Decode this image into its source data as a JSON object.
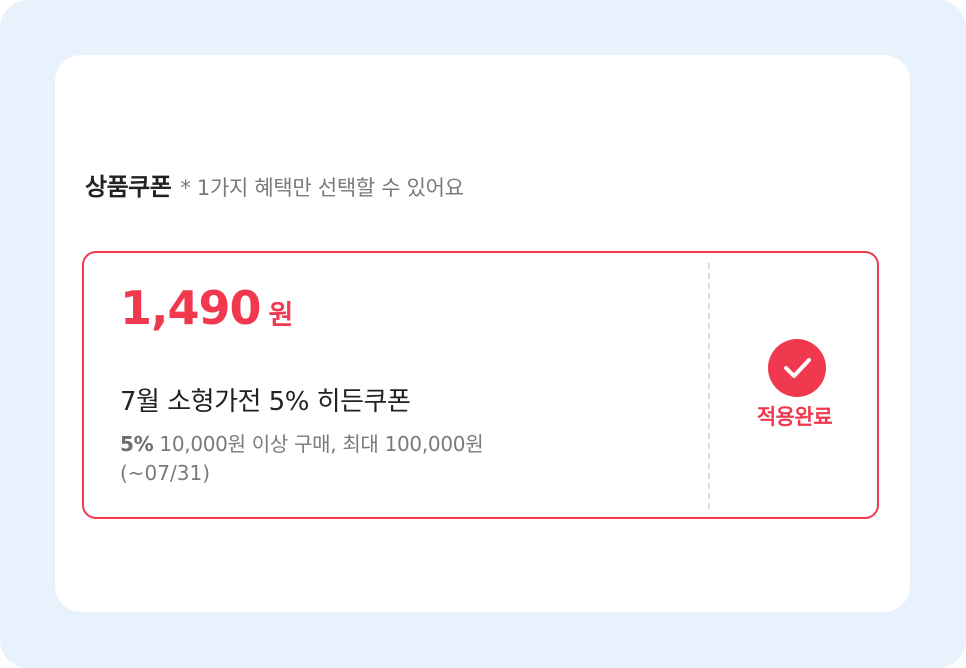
{
  "section": {
    "title": "상품쿠폰",
    "note": "* 1가지 혜택만 선택할 수 있어요"
  },
  "coupon": {
    "amount": "1,490",
    "amount_unit": "원",
    "name": "7월 소형가전 5% 히든쿠폰",
    "condition_rate": "5%",
    "condition_text": " 10,000원 이상 구매, 최대 100,000원",
    "period": "(~07/31)",
    "status_icon": "check-circle-icon",
    "status_label": "적용완료"
  },
  "colors": {
    "accent": "#f0394f",
    "background": "#e7f2fc",
    "card": "#ffffff"
  }
}
